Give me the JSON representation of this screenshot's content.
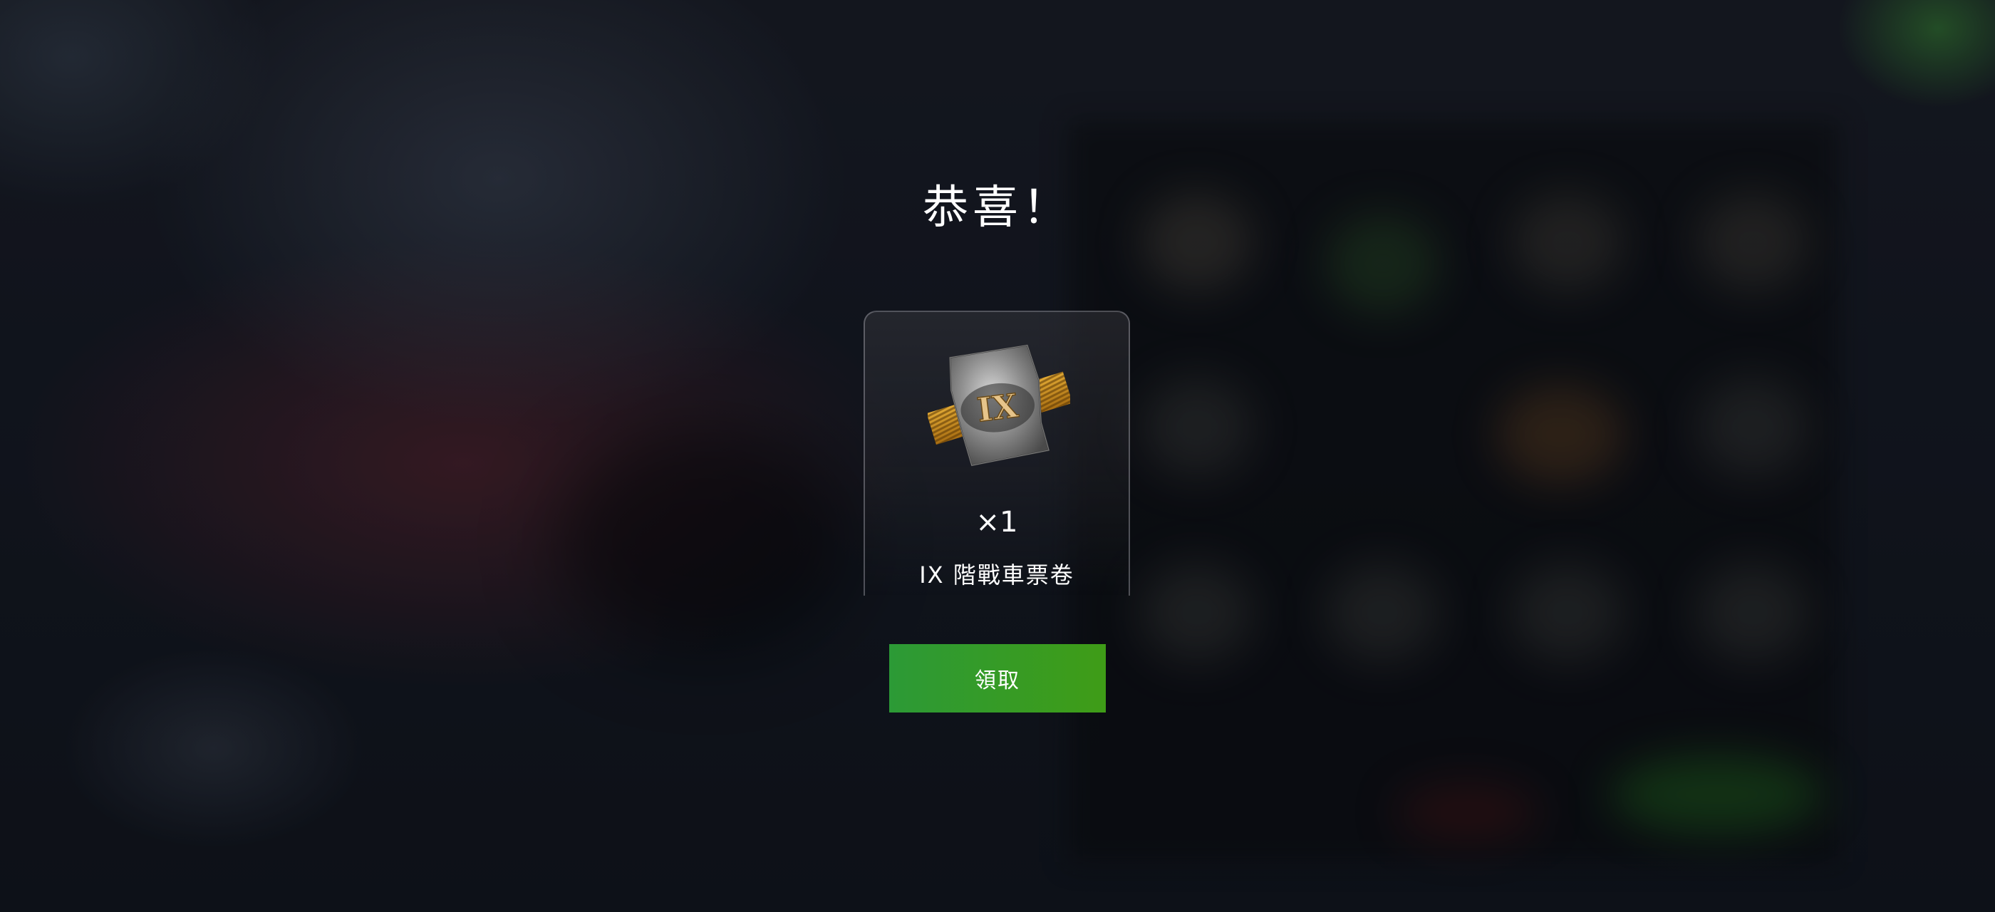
{
  "dialog": {
    "title": "恭喜！",
    "reward": {
      "icon": "tier-ix-ticket-icon",
      "icon_text": "IX",
      "quantity": "×1",
      "name": "IX 階戰車票卷"
    },
    "claim_label": "領取"
  },
  "colors": {
    "claim_button": "#35a02a",
    "ribbon": "#c8901e"
  }
}
